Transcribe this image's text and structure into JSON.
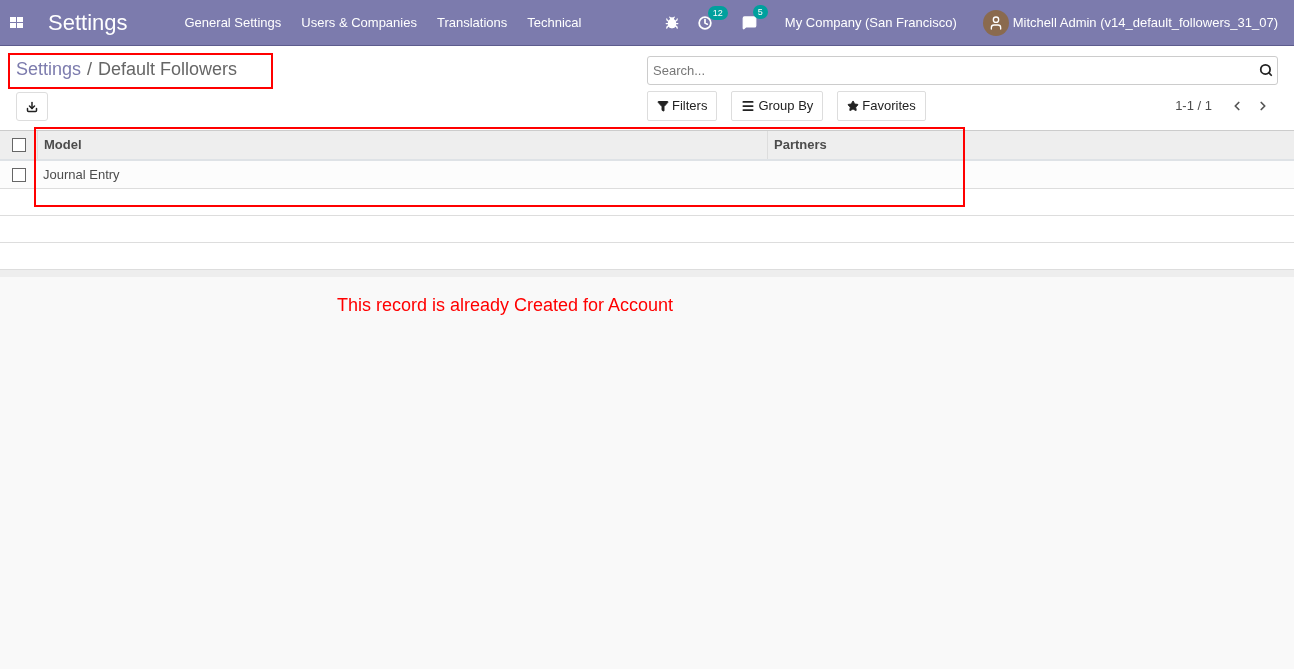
{
  "navbar": {
    "app_title": "Settings",
    "menu": [
      "General Settings",
      "Users & Companies",
      "Translations",
      "Technical"
    ],
    "activity_count": "12",
    "message_count": "5",
    "company": "My Company (San Francisco)",
    "user": "Mitchell Admin (v14_default_followers_31_07)"
  },
  "breadcrumb": [
    "Settings",
    "Default Followers"
  ],
  "breadcrumb_separator": "/",
  "search": {
    "placeholder": "Search..."
  },
  "filters": [
    {
      "kind": "filter",
      "label": "Filters"
    },
    {
      "kind": "group",
      "label": "Group By"
    },
    {
      "kind": "star",
      "label": "Favorites"
    }
  ],
  "pager": "1-1 / 1",
  "table": {
    "columns": [
      "Model",
      "Partners"
    ],
    "header_checked": false,
    "rows": [
      {
        "cells": [
          "Journal Entry"
        ],
        "checked": false
      }
    ]
  },
  "annotation": "This record is already Created for Account"
}
